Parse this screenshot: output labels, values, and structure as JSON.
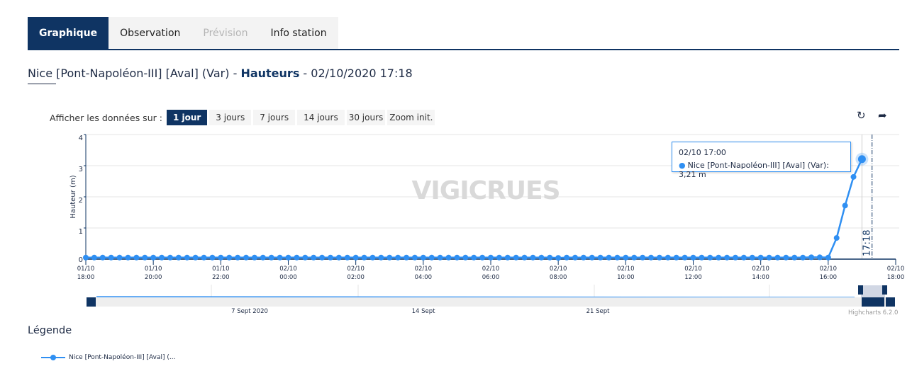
{
  "tabs": [
    {
      "label": "Graphique",
      "state": "active"
    },
    {
      "label": "Observation",
      "state": "normal"
    },
    {
      "label": "Prévision",
      "state": "disabled"
    },
    {
      "label": "Info station",
      "state": "normal"
    }
  ],
  "title": {
    "station": "Nice [Pont-Napoléon-III] [Aval] (Var) - ",
    "measure": "Hauteurs",
    "datetime": " - 02/10/2020 17:18"
  },
  "range": {
    "label": "Afficher les données sur :",
    "buttons": [
      "1 jour",
      "3 jours",
      "7 jours",
      "14 jours",
      "30 jours",
      "Zoom init."
    ],
    "active": "1 jour"
  },
  "icons": {
    "refresh": "refresh-icon",
    "share": "share-arrow-icon"
  },
  "watermark": "VIGICRUES",
  "tooltip": {
    "header": "02/10 17:00",
    "series": "Nice [Pont-Napoléon-III] [Aval] (Var)",
    "value": "3,21 m"
  },
  "navigator": {
    "labels": [
      "7 Sept 2020",
      "14 Sept",
      "21 Sept"
    ]
  },
  "credits": "Highcharts 6.2.0",
  "legend": {
    "title": "Légende",
    "item": "Nice [Pont-Napoléon-III] [Aval] (..."
  },
  "colors": {
    "series": "#2f8ff2",
    "brand": "#0f3463"
  },
  "chart_data": {
    "type": "line",
    "ylabel": "Hauteur (m)",
    "ylim": [
      0,
      4
    ],
    "yticks": [
      "0",
      "1",
      "2",
      "3",
      "4"
    ],
    "xlim": [
      "01/10 18:00",
      "02/10 18:00"
    ],
    "xticks": [
      [
        "01/10",
        "18:00"
      ],
      [
        "01/10",
        "20:00"
      ],
      [
        "01/10",
        "22:00"
      ],
      [
        "02/10",
        "00:00"
      ],
      [
        "02/10",
        "02:00"
      ],
      [
        "02/10",
        "04:00"
      ],
      [
        "02/10",
        "06:00"
      ],
      [
        "02/10",
        "08:00"
      ],
      [
        "02/10",
        "10:00"
      ],
      [
        "02/10",
        "12:00"
      ],
      [
        "02/10",
        "14:00"
      ],
      [
        "02/10",
        "16:00"
      ],
      [
        "02/10",
        "18:00"
      ]
    ],
    "current_time_marker": "17:18",
    "grid": true,
    "series": [
      {
        "name": "Nice [Pont-Napoléon-III] [Aval] (Var)",
        "x": [
          "01/10 18:00",
          "01/10 18:15",
          "01/10 18:30",
          "01/10 18:45",
          "01/10 19:00",
          "01/10 19:15",
          "01/10 19:30",
          "01/10 19:45",
          "01/10 20:00",
          "01/10 20:15",
          "01/10 20:30",
          "01/10 20:45",
          "01/10 21:00",
          "01/10 21:15",
          "01/10 21:30",
          "01/10 21:45",
          "01/10 22:00",
          "01/10 22:15",
          "01/10 22:30",
          "01/10 22:45",
          "01/10 23:00",
          "01/10 23:15",
          "01/10 23:30",
          "01/10 23:45",
          "02/10 00:00",
          "02/10 00:15",
          "02/10 00:30",
          "02/10 00:45",
          "02/10 01:00",
          "02/10 01:15",
          "02/10 01:30",
          "02/10 01:45",
          "02/10 02:00",
          "02/10 02:15",
          "02/10 02:30",
          "02/10 02:45",
          "02/10 03:00",
          "02/10 03:15",
          "02/10 03:30",
          "02/10 03:45",
          "02/10 04:00",
          "02/10 04:15",
          "02/10 04:30",
          "02/10 04:45",
          "02/10 05:00",
          "02/10 05:15",
          "02/10 05:30",
          "02/10 05:45",
          "02/10 06:00",
          "02/10 06:15",
          "02/10 06:30",
          "02/10 06:45",
          "02/10 07:00",
          "02/10 07:15",
          "02/10 07:30",
          "02/10 07:45",
          "02/10 08:00",
          "02/10 08:15",
          "02/10 08:30",
          "02/10 08:45",
          "02/10 09:00",
          "02/10 09:15",
          "02/10 09:30",
          "02/10 09:45",
          "02/10 10:00",
          "02/10 10:15",
          "02/10 10:30",
          "02/10 10:45",
          "02/10 11:00",
          "02/10 11:15",
          "02/10 11:30",
          "02/10 11:45",
          "02/10 12:00",
          "02/10 12:15",
          "02/10 12:30",
          "02/10 12:45",
          "02/10 13:00",
          "02/10 13:15",
          "02/10 13:30",
          "02/10 13:45",
          "02/10 14:00",
          "02/10 14:15",
          "02/10 14:30",
          "02/10 14:45",
          "02/10 15:00",
          "02/10 15:15",
          "02/10 15:30",
          "02/10 15:45",
          "02/10 16:00",
          "02/10 16:15",
          "02/10 16:30",
          "02/10 16:45",
          "02/10 17:00"
        ],
        "y": [
          0.05,
          0.05,
          0.05,
          0.05,
          0.05,
          0.05,
          0.05,
          0.05,
          0.05,
          0.05,
          0.05,
          0.05,
          0.05,
          0.05,
          0.05,
          0.05,
          0.05,
          0.05,
          0.05,
          0.05,
          0.05,
          0.05,
          0.05,
          0.05,
          0.05,
          0.05,
          0.05,
          0.05,
          0.05,
          0.05,
          0.05,
          0.05,
          0.05,
          0.05,
          0.05,
          0.05,
          0.05,
          0.05,
          0.05,
          0.05,
          0.05,
          0.05,
          0.05,
          0.05,
          0.05,
          0.05,
          0.05,
          0.05,
          0.05,
          0.05,
          0.05,
          0.05,
          0.05,
          0.05,
          0.05,
          0.05,
          0.04,
          0.05,
          0.05,
          0.05,
          0.05,
          0.05,
          0.05,
          0.05,
          0.05,
          0.05,
          0.05,
          0.05,
          0.05,
          0.05,
          0.05,
          0.05,
          0.05,
          0.05,
          0.05,
          0.05,
          0.05,
          0.05,
          0.05,
          0.05,
          0.05,
          0.05,
          0.05,
          0.05,
          0.05,
          0.05,
          0.06,
          0.06,
          0.05,
          0.68,
          1.72,
          2.64,
          3.21
        ]
      }
    ]
  }
}
